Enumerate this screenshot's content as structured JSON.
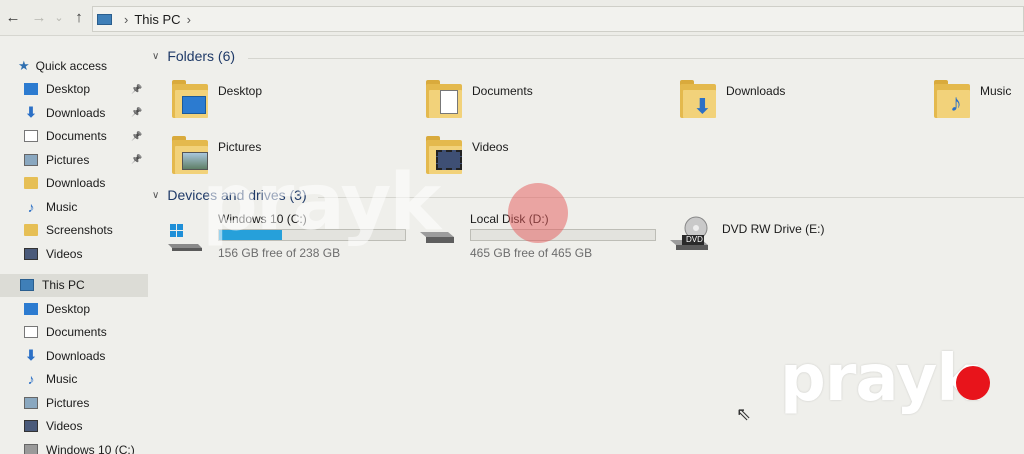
{
  "address_bar": {
    "back_glyph": "←",
    "forward_glyph": "→",
    "dropdown_glyph": "⌄",
    "up_glyph": "↑",
    "location": "This PC"
  },
  "nav": {
    "quick_access_label": "Quick access",
    "quick_access_items": [
      {
        "label": "Desktop",
        "icon": "desktop-icon",
        "pinned": true
      },
      {
        "label": "Downloads",
        "icon": "download-icon",
        "pinned": true
      },
      {
        "label": "Documents",
        "icon": "documents-icon",
        "pinned": true
      },
      {
        "label": "Pictures",
        "icon": "pictures-icon",
        "pinned": true
      },
      {
        "label": "Downloads",
        "icon": "folder-icon",
        "pinned": false
      },
      {
        "label": "Music",
        "icon": "music-icon",
        "pinned": false
      },
      {
        "label": "Screenshots",
        "icon": "folder-icon",
        "pinned": false
      },
      {
        "label": "Videos",
        "icon": "videos-icon",
        "pinned": false
      }
    ],
    "this_pc_label": "This PC",
    "this_pc_items": [
      {
        "label": "Desktop",
        "icon": "desktop-icon"
      },
      {
        "label": "Documents",
        "icon": "documents-icon"
      },
      {
        "label": "Downloads",
        "icon": "download-icon"
      },
      {
        "label": "Music",
        "icon": "music-icon"
      },
      {
        "label": "Pictures",
        "icon": "pictures-icon"
      },
      {
        "label": "Videos",
        "icon": "videos-icon"
      },
      {
        "label": "Windows 10 (C:)",
        "icon": "drive-icon"
      }
    ]
  },
  "folders_group": {
    "header": "Folders (6)",
    "items": [
      {
        "label": "Desktop",
        "overlay": "desktop"
      },
      {
        "label": "Documents",
        "overlay": "documents"
      },
      {
        "label": "Downloads",
        "overlay": "downloads"
      },
      {
        "label": "Music",
        "overlay": "music"
      },
      {
        "label": "Pictures",
        "overlay": "pictures"
      },
      {
        "label": "Videos",
        "overlay": "videos"
      }
    ]
  },
  "devices_group": {
    "header": "Devices and drives (3)",
    "drives": [
      {
        "name": "Windows 10 (C:)",
        "free": "156 GB free of 238 GB",
        "used_fraction": 0.34,
        "icon": "windows-drive-icon"
      },
      {
        "name": "Local Disk (D:)",
        "free": "465 GB free of 465 GB",
        "used_fraction": 0.0,
        "icon": "hard-drive-icon"
      },
      {
        "name": "DVD RW Drive (E:)",
        "icon": "dvd-drive-icon",
        "badge": "DVD"
      }
    ]
  },
  "watermark": {
    "text": "prayk",
    "color": "#e8141b"
  },
  "colors": {
    "accent": "#26a0da",
    "folder": "#e4b94d",
    "header_text": "#1f3a68"
  }
}
